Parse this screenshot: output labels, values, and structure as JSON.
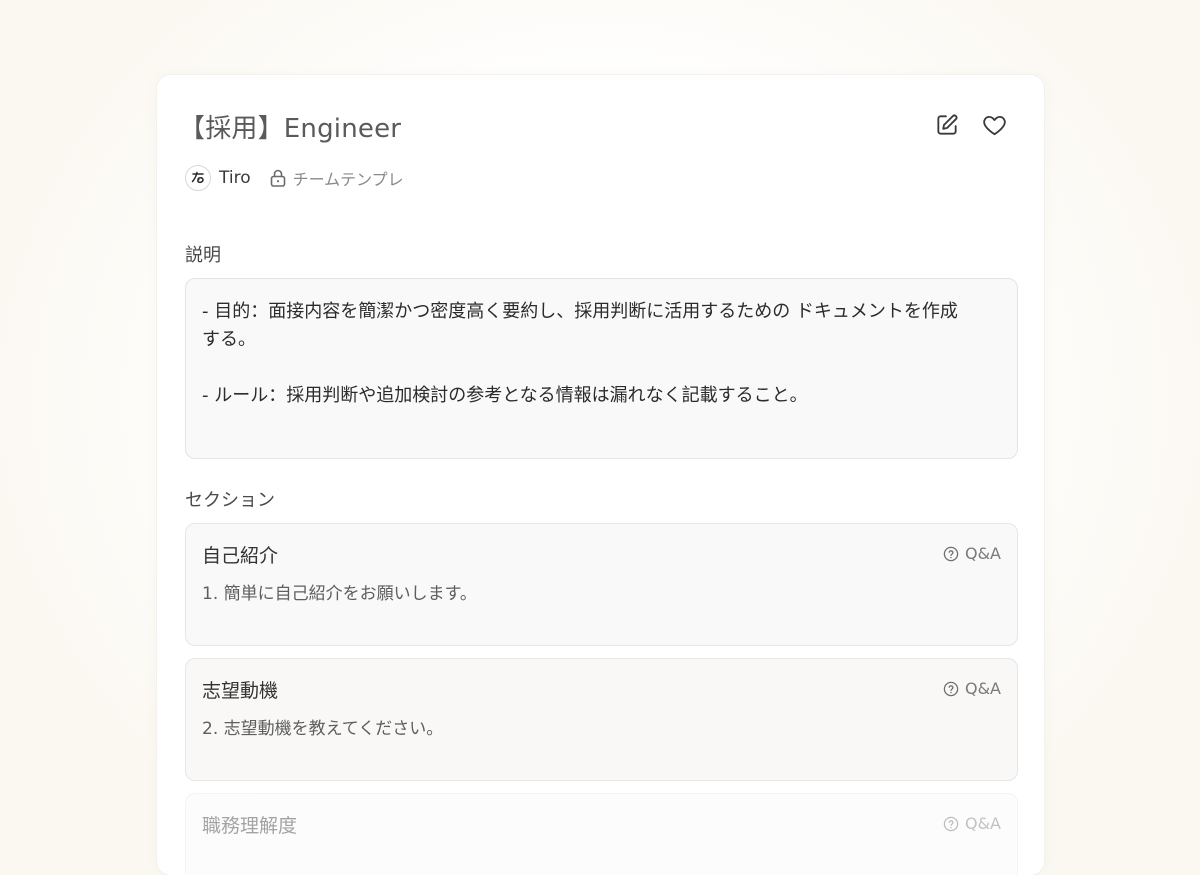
{
  "template": {
    "title": "【採用】Engineer",
    "author": "Tiro",
    "visibility": "チームテンプレ"
  },
  "icons": {
    "edit": "edit-icon",
    "favorite": "heart-icon",
    "avatar": "tiro-logo-icon",
    "lock": "lock-icon",
    "section_type": "question-circle-icon"
  },
  "description": {
    "label": "説明",
    "lines": [
      "- 目的：面接内容を簡潔かつ密度高く要約し、採用判断に活用するための ドキュメントを作成",
      "する。",
      "",
      "- ルール：採用判断や追加検討の参考となる情報は漏れなく記載すること。"
    ]
  },
  "sections": {
    "label": "セクション",
    "items": [
      {
        "title": "自己紹介",
        "type": "Q&A",
        "body": "1. 簡単に自己紹介をお願いします。"
      },
      {
        "title": "志望動機",
        "type": "Q&A",
        "body": "2. 志望動機を教えてください。"
      },
      {
        "title": "職務理解度",
        "type": "Q&A",
        "body": ""
      }
    ]
  }
}
